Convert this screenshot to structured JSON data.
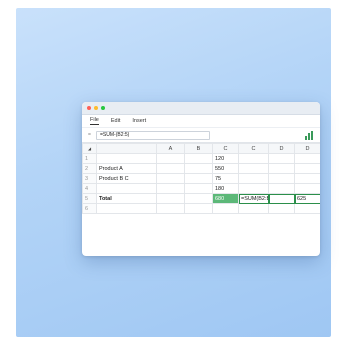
{
  "menu": {
    "items": [
      {
        "label": "File",
        "active": true
      },
      {
        "label": "Edit",
        "active": false
      },
      {
        "label": "Insert",
        "active": false
      }
    ]
  },
  "formula_bar": {
    "fx_label": "=",
    "value": "=SUM-(B2:5)"
  },
  "grid": {
    "corner": "◢",
    "columns": [
      "",
      "A",
      "B",
      "C",
      "C",
      "D",
      "D"
    ],
    "rows": [
      {
        "num": "1",
        "label": "",
        "a": "",
        "b": "",
        "c": "120",
        "c2": "",
        "d": "",
        "d2": ""
      },
      {
        "num": "2",
        "label": "Product A",
        "a": "",
        "b": "",
        "c": "550",
        "c2": "",
        "d": "",
        "d2": ""
      },
      {
        "num": "3",
        "label": "Product B C",
        "a": "",
        "b": "",
        "c": "75",
        "c2": "",
        "d": "",
        "d2": ""
      },
      {
        "num": "4",
        "label": "",
        "a": "",
        "b": "",
        "c": "180",
        "c2": "",
        "d": "",
        "d2": ""
      },
      {
        "num": "5",
        "label": "Total",
        "a": "",
        "b": "",
        "c": "680",
        "c2": "=SUM(B2:B5",
        "d": "",
        "d2": "625"
      },
      {
        "num": "6",
        "label": "",
        "a": "",
        "b": "",
        "c": "",
        "c2": "",
        "d": "",
        "d2": ""
      }
    ]
  },
  "colors": {
    "accent": "#5cb878",
    "selection_border": "#2b8f4a",
    "background_gradient_start": "#c9e1fb",
    "background_gradient_end": "#9fc7f3"
  },
  "icons": {
    "chart": "bar-chart-icon"
  }
}
